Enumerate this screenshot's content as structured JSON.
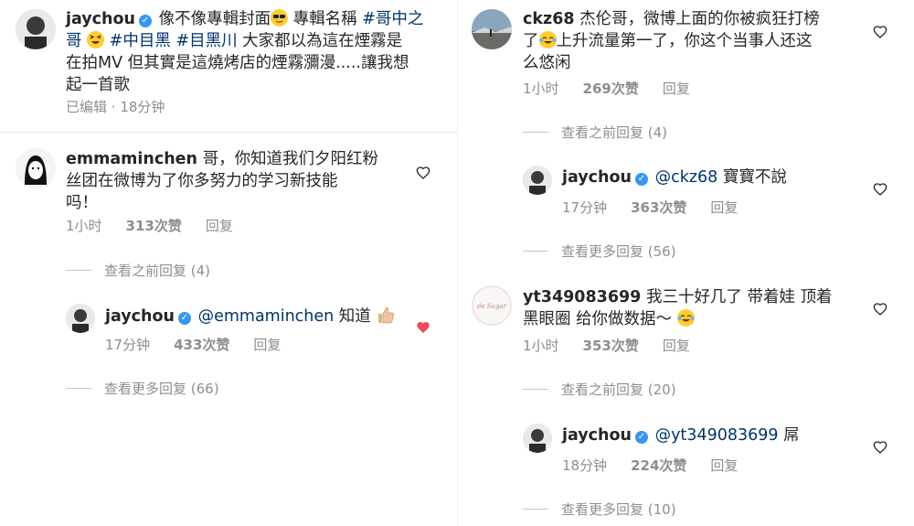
{
  "left": {
    "post": {
      "username": "jaychou",
      "text_a": "像不像專輯封面",
      "text_b": " 專輯名稱 ",
      "tag1": "#哥中之",
      "tag1b": "哥",
      "tag2": "#中目黑",
      "tag3": "#目黑川",
      "text_c": " 大家都以為這在煙霧是",
      "line3": "在拍MV 但其實是這燒烤店的煙霧瀰漫.....讓我想",
      "line4": "起一首歌",
      "meta_edited": "已编辑",
      "meta_dot": " · ",
      "meta_time": "18分钟"
    },
    "c1": {
      "username": "emmaminchen",
      "line1": " 哥，你知道我们夕阳红粉",
      "line2": "丝团在微博为了你多努力的学习新技能",
      "line3": "吗！",
      "time": "1小时",
      "likes": "313次赞",
      "reply": "回复",
      "view_prev": "查看之前回复 (4)"
    },
    "r1": {
      "username": "jaychou",
      "mention": "@emmaminchen",
      "text": " 知道",
      "time": "17分钟",
      "likes": "433次赞",
      "reply": "回复",
      "view_more": "查看更多回复 (66)"
    }
  },
  "right": {
    "c1": {
      "username": "ckz68",
      "line1": " 杰伦哥，微博上面的你被疯狂打榜",
      "line2a": "了",
      "line2b": "上升流量第一了，你这个当事人还这",
      "line3": "么悠闲",
      "time": "1小时",
      "likes": "269次赞",
      "reply": "回复",
      "view_prev": "查看之前回复 (4)"
    },
    "r1": {
      "username": "jaychou",
      "mention": "@ckz68",
      "text": " 寶寶不說",
      "time": "17分钟",
      "likes": "363次赞",
      "reply": "回复",
      "view_more": "查看更多回复 (56)"
    },
    "c2": {
      "username": "yt349083699",
      "line1": " 我三十好几了 带着娃 顶着",
      "line2": "黑眼圈 给你做数据～",
      "time": "1小时",
      "likes": "353次赞",
      "reply": "回复",
      "view_prev": "查看之前回复 (20)"
    },
    "r2": {
      "username": "jaychou",
      "mention": "@yt349083699",
      "text": " 屌",
      "time": "18分钟",
      "likes": "224次赞",
      "reply": "回复",
      "view_more": "查看更多回复 (10)"
    }
  },
  "icons": {
    "verified": "verified-badge-icon",
    "heart": "heart-icon",
    "heart_liked_color": "#ed4956",
    "link_color": "#003569"
  }
}
